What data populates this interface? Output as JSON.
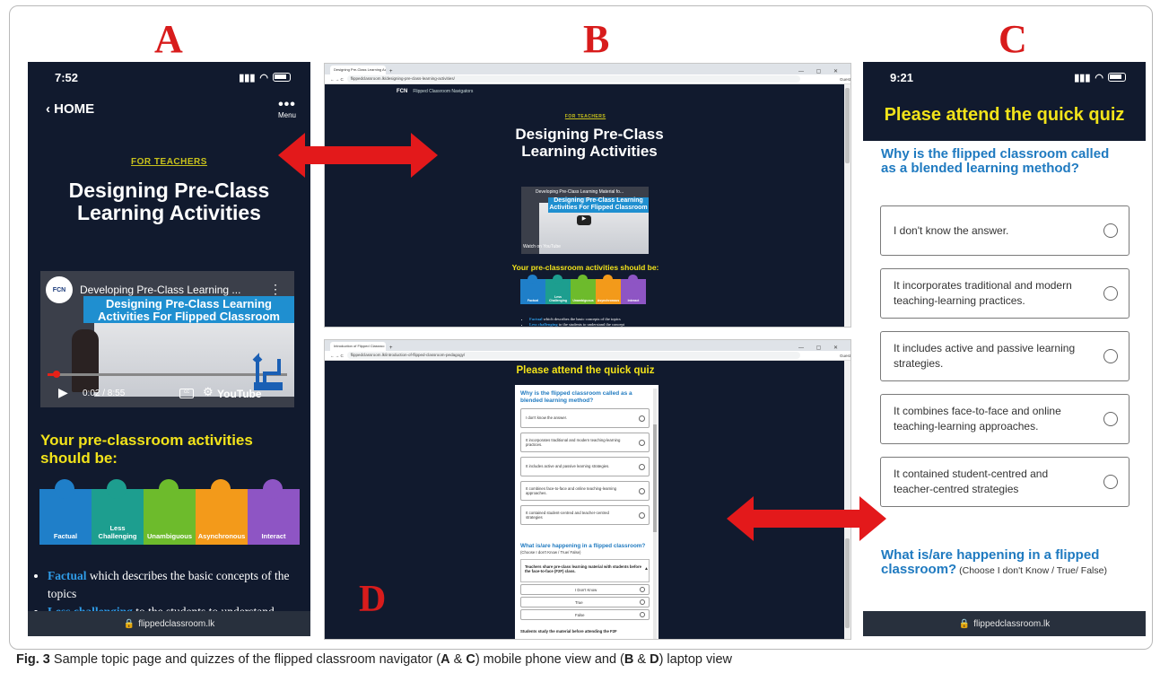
{
  "panel_letters": {
    "a": "A",
    "b": "B",
    "c": "C",
    "d": "D"
  },
  "phone_a": {
    "time": "7:52",
    "back_label": "‹ HOME",
    "menu_dots": "•••",
    "menu_label": "Menu",
    "kicker": "FOR TEACHERS",
    "title": "Designing Pre-Class Learning Activities",
    "video": {
      "channel_title": "Developing Pre-Class Learning ...",
      "banner": "Designing Pre-Class Learning Activities For Flipped Classroom",
      "time": "0:02 / 8:55",
      "platform": "YouTube",
      "logo": "FCN",
      "more": "⋮"
    },
    "section_heading": "Your pre-classroom activities should be:",
    "puzzle": [
      {
        "label": "Factual",
        "color": "#1f7fc9"
      },
      {
        "label": "Less Challenging",
        "color": "#1d9e8f"
      },
      {
        "label": "Unambiguous",
        "color": "#6dbb2c"
      },
      {
        "label": "Asynchronous",
        "color": "#f39a1a"
      },
      {
        "label": "Interact",
        "color": "#8e55c4"
      }
    ],
    "bullets": [
      {
        "term": "Factual",
        "text": " which describes the basic concepts of the topics"
      },
      {
        "term": "Less challenging",
        "text": " to the students to understand"
      }
    ],
    "url": "flippedclassroom.lk"
  },
  "laptop_b": {
    "tab_title": "Designing Pre-Class Learning Ac",
    "url": "flippedclassroom.lk/designing-pre-class-learning-activities/",
    "guest": "Guest",
    "brand": "FCN",
    "brand_sub": "Flipped Classroom Navigators",
    "kicker": "FOR TEACHERS",
    "title": "Designing Pre-Class Learning Activities",
    "video_title": "Developing Pre-Class Learning Material fo...",
    "video_banner": "Designing Pre-Class Learning Activities For Flipped Classroom",
    "watch_on": "Watch on",
    "platform": "YouTube",
    "section_heading": "Your pre-classroom activities should be:",
    "puzzle": [
      "Factual",
      "Less Challenging",
      "Unambiguous",
      "Asynchronous",
      "Interact"
    ],
    "bullets": [
      {
        "term": "Factual",
        "text": " which describes the basic concepts of the topics"
      },
      {
        "term": "Less challenging",
        "text": " to the students to understand the concept"
      }
    ]
  },
  "laptop_d": {
    "tab_title": "Introduction of Flipped Classroo",
    "url": "flippedclassroom.lk/introduction-of-flipped-classroom-pedagogy/",
    "guest": "Guest",
    "quiz_title": "Please attend the quick quiz",
    "q1": "Why is the flipped classroom called as a blended learning method?",
    "options": [
      "I don't know the answer.",
      "It incorporates traditional and modern teaching-learning practices.",
      "It includes active and passive learning strategies.",
      "It combines face-to-face and online teaching-learning approaches.",
      "It contained student-centred and teacher-centred strategies"
    ],
    "q2": "What is/are happening in a flipped classroom?",
    "q2_sub": "(Choose I don't Know / True/ False)",
    "statement": "Teachers share pre-class learning material with students before the face-to-face (F2F) class.",
    "choices": [
      "I Don't Know",
      "True",
      "False"
    ],
    "statement2": "Students study the material before attending the F2F"
  },
  "phone_c": {
    "time": "9:21",
    "quiz_title": "Please attend the quick quiz",
    "q1": "Why is the flipped classroom called as a blended learning method?",
    "options": [
      "I don't know the answer.",
      "It incorporates traditional and modern teaching-learning practices.",
      "It includes active and passive learning strategies.",
      "It combines face-to-face and online teaching-learning approaches.",
      "It contained student-centred and teacher-centred strategies"
    ],
    "q2": "What is/are happening in a flipped classroom?",
    "q2_sub": " (Choose I don't Know / True/ False)",
    "url": "flippedclassroom.lk"
  },
  "caption": {
    "fig": "Fig. 3",
    "text_1": "  Sample topic page and quizzes of the flipped classroom navigator (",
    "a": "A",
    "amp1": " & ",
    "c": "C",
    "text_2": ") mobile phone view and (",
    "b": "B",
    "amp2": " & ",
    "d": "D",
    "text_3": ") laptop view"
  },
  "colors": {
    "dark_navy": "#111a2e",
    "quiz_yellow": "#f2e31a",
    "question_blue": "#1f7ac0",
    "arrow_red": "#e3191b",
    "letter_red": "#d81c1c"
  }
}
